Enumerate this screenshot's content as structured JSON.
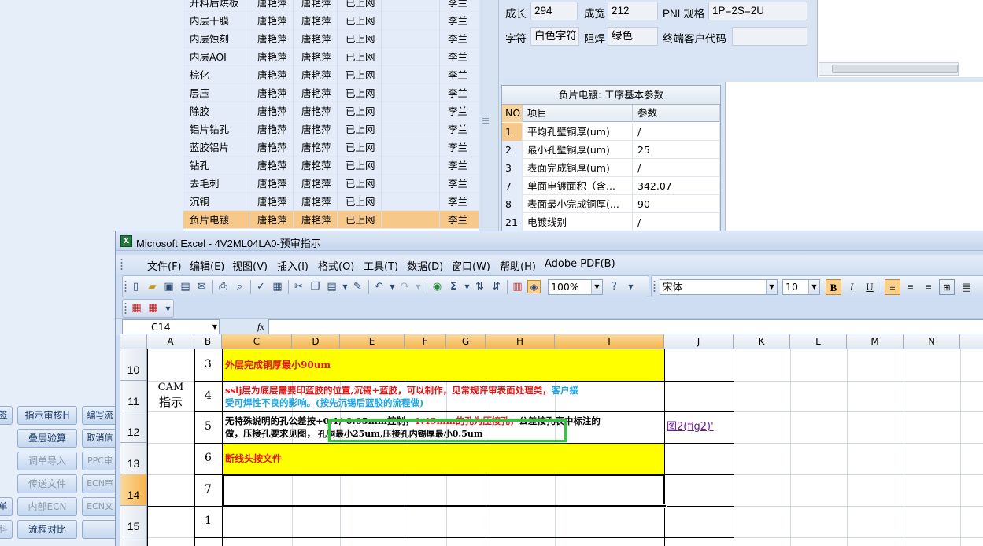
{
  "process_list": {
    "rows": [
      {
        "step": "开料后烘板",
        "a": "唐艳萍",
        "b": "唐艳萍",
        "status": "已上网",
        "c": "",
        "owner": "李兰"
      },
      {
        "step": "内层干膜",
        "a": "唐艳萍",
        "b": "唐艳萍",
        "status": "已上网",
        "c": "",
        "owner": "李兰"
      },
      {
        "step": "内层蚀刻",
        "a": "唐艳萍",
        "b": "唐艳萍",
        "status": "已上网",
        "c": "",
        "owner": "李兰"
      },
      {
        "step": "内层AOI",
        "a": "唐艳萍",
        "b": "唐艳萍",
        "status": "已上网",
        "c": "",
        "owner": "李兰"
      },
      {
        "step": "棕化",
        "a": "唐艳萍",
        "b": "唐艳萍",
        "status": "已上网",
        "c": "",
        "owner": "李兰"
      },
      {
        "step": "层压",
        "a": "唐艳萍",
        "b": "唐艳萍",
        "status": "已上网",
        "c": "",
        "owner": "李兰"
      },
      {
        "step": "除胶",
        "a": "唐艳萍",
        "b": "唐艳萍",
        "status": "已上网",
        "c": "",
        "owner": "李兰"
      },
      {
        "step": "铝片钻孔",
        "a": "唐艳萍",
        "b": "唐艳萍",
        "status": "已上网",
        "c": "",
        "owner": "李兰"
      },
      {
        "step": "蓝胶铝片",
        "a": "唐艳萍",
        "b": "唐艳萍",
        "status": "已上网",
        "c": "",
        "owner": "李兰"
      },
      {
        "step": "钻孔",
        "a": "唐艳萍",
        "b": "唐艳萍",
        "status": "已上网",
        "c": "",
        "owner": "李兰"
      },
      {
        "step": "去毛刺",
        "a": "唐艳萍",
        "b": "唐艳萍",
        "status": "已上网",
        "c": "",
        "owner": "李兰"
      },
      {
        "step": "沉铜",
        "a": "唐艳萍",
        "b": "唐艳萍",
        "status": "已上网",
        "c": "",
        "owner": "李兰"
      },
      {
        "step": "负片电镀",
        "a": "唐艳萍",
        "b": "唐艳萍",
        "status": "已上网",
        "c": "",
        "owner": "李兰"
      }
    ]
  },
  "info": {
    "length_label": "成长",
    "length_value": "294",
    "width_label": "成宽",
    "width_value": "212",
    "pnl_label": "PNL规格",
    "pnl_value": "1P=2S=2U",
    "char_label": "字符",
    "char_value": "白色字符",
    "mask_label": "阻焊",
    "mask_value": "绿色",
    "customer_label": "终端客户代码",
    "customer_value": ""
  },
  "params": {
    "title": "负片电镀: 工序基本参数",
    "col_no": "NO",
    "col_item": "项目",
    "col_value": "参数",
    "rows": [
      {
        "no": "1",
        "item": "平均孔壁铜厚(um)",
        "value": "/"
      },
      {
        "no": "2",
        "item": "最小孔壁铜厚(um)",
        "value": "25"
      },
      {
        "no": "3",
        "item": "表面完成铜厚(um)",
        "value": "/"
      },
      {
        "no": "7",
        "item": "单面电镀面积（含...",
        "value": "342.07"
      },
      {
        "no": "8",
        "item": "表面最小完成铜厚(...",
        "value": "90"
      },
      {
        "no": "21",
        "item": "电镀线别",
        "value": "/"
      }
    ]
  },
  "side_buttons": [
    {
      "label": "签",
      "dim": false
    },
    {
      "label": "指示审核H",
      "dim": false
    },
    {
      "label": "编写流",
      "dim": false
    },
    {
      "label": "叠层验算",
      "dim": false
    },
    {
      "label": "取消信",
      "dim": false
    },
    {
      "label": "调单导入",
      "dim": true
    },
    {
      "label": "PPC审",
      "dim": true
    },
    {
      "label": "传送文件",
      "dim": true
    },
    {
      "label": "ECN审",
      "dim": true
    },
    {
      "label": "单",
      "dim": false
    },
    {
      "label": "内部ECN",
      "dim": true
    },
    {
      "label": "ECN文",
      "dim": true
    },
    {
      "label": "科",
      "dim": true
    },
    {
      "label": "流程对比",
      "dim": false
    }
  ],
  "excel": {
    "title": "Microsoft Excel - 4V2ML04LA0-预审指示",
    "menu": [
      "文件(F)",
      "编辑(E)",
      "视图(V)",
      "插入(I)",
      "格式(O)",
      "工具(T)",
      "数据(D)",
      "窗口(W)",
      "帮助(H)",
      "Adobe PDF(B)"
    ],
    "zoom": "100%",
    "font_name": "宋体",
    "font_size": "10",
    "name_box": "C14",
    "fx": "fx",
    "columns": [
      "A",
      "B",
      "C",
      "D",
      "E",
      "F",
      "G",
      "H",
      "I",
      "J",
      "K",
      "L",
      "M",
      "N"
    ],
    "row_numbers": [
      "10",
      "11",
      "12",
      "13",
      "14",
      "15"
    ],
    "section_label_1": "CAM",
    "section_label_2": "指示",
    "items": [
      {
        "num": "3"
      },
      {
        "num": "4"
      },
      {
        "num": "5"
      },
      {
        "num": "6"
      },
      {
        "num": "7"
      },
      {
        "num": "1"
      }
    ],
    "text_row3": "外层完成铜厚最小90um",
    "text_row4_a": "sslj层为底层需要印蓝胶的位置,沉锡+蓝胶，可以制作，见常规评审表面处理类，",
    "text_row4_b": "客户接",
    "text_row4_c": "受可焊性不良的影响。(按先沉锡后蓝胶的流程做)",
    "text_row5_a": "无特殊说明的孔公差按+0.1/-0.05mm控制，",
    "text_row5_b": "1.45mm的孔为压接孔，",
    "text_row5_c": "公差按孔表中标注的",
    "text_row5_d": "做，压接孔要求见图，",
    "text_row5_e": "孔铜最小25um,压接孔内锡厚最小0.5um",
    "text_row5_link": "图2(fig2)'",
    "text_row6": "断线头按文件"
  }
}
